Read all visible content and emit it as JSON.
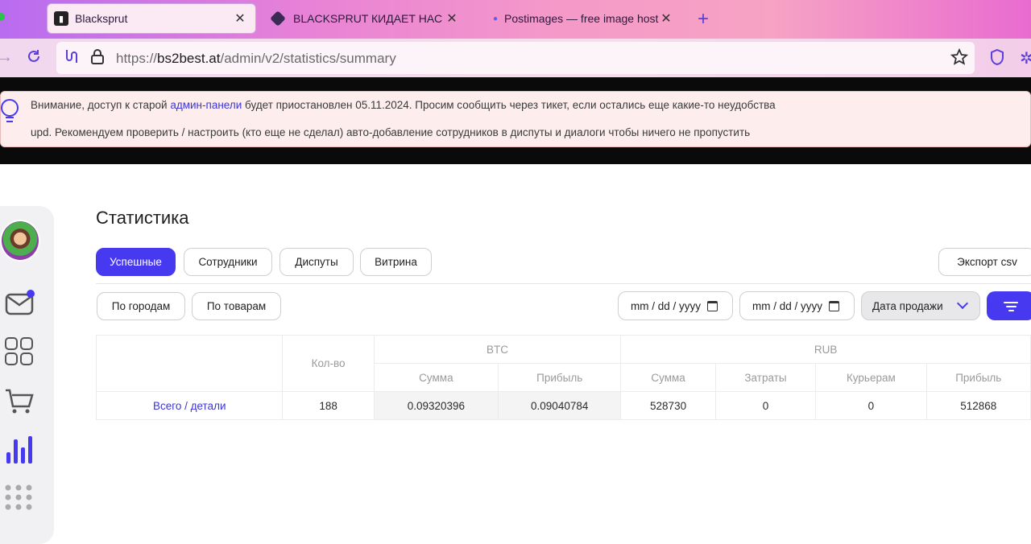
{
  "browser": {
    "tabs": [
      {
        "title": "Blacksprut",
        "active": true
      },
      {
        "title": "BLACKSPRUT КИДАЕТ НАС НА"
      },
      {
        "title": "Postimages — free image hostir"
      }
    ],
    "url_scheme": "https://",
    "url_host": "bs2best.at",
    "url_path": "/admin/v2/statistics/summary"
  },
  "notice": {
    "line1_before": "Внимание, доступ к старой ",
    "line1_link": "админ-панели",
    "line1_after": " будет приостановлен 05.11.2024. Просим сообщить через тикет, если остались еще какие-то неудобства",
    "line2": "upd. Рекомендуем проверить / настроить (кто еще не сделал) авто-добавление сотрудников в диспуты и диалоги чтобы ничего не пропустить"
  },
  "sidebar": {
    "icons": [
      "avatar",
      "mail-icon",
      "grid-icon",
      "cart-icon",
      "chart-icon",
      "apps-icon"
    ],
    "mail_badge_color": "#4639f0"
  },
  "page": {
    "title": "Статистика",
    "tabs": [
      "Успешные",
      "Сотрудники",
      "Диспуты",
      "Витрина"
    ],
    "export_label": "Экспорт csv",
    "filters": [
      "По городам",
      "По товарам"
    ],
    "date_from_placeholder": "mm / dd / yyyy",
    "date_to_placeholder": "mm / dd / yyyy",
    "date_type_selected": "Дата продажи"
  },
  "table": {
    "headers": {
      "qty": "Кол-во",
      "btc": "BTC",
      "rub": "RUB",
      "btc_sum": "Сумма",
      "btc_profit": "Прибыль",
      "rub_sum": "Сумма",
      "rub_costs": "Затраты",
      "rub_couriers": "Курьерам",
      "rub_profit": "Прибыль"
    },
    "row": {
      "label": "Всего / детали",
      "qty": "188",
      "btc_sum": "0.09320396",
      "btc_profit": "0.09040784",
      "rub_sum": "528730",
      "rub_costs": "0",
      "rub_couriers": "0",
      "rub_profit": "512868"
    }
  },
  "colors": {
    "accent": "#4639f0",
    "link": "#3b35d6",
    "notice_bg": "#fdeeed"
  }
}
